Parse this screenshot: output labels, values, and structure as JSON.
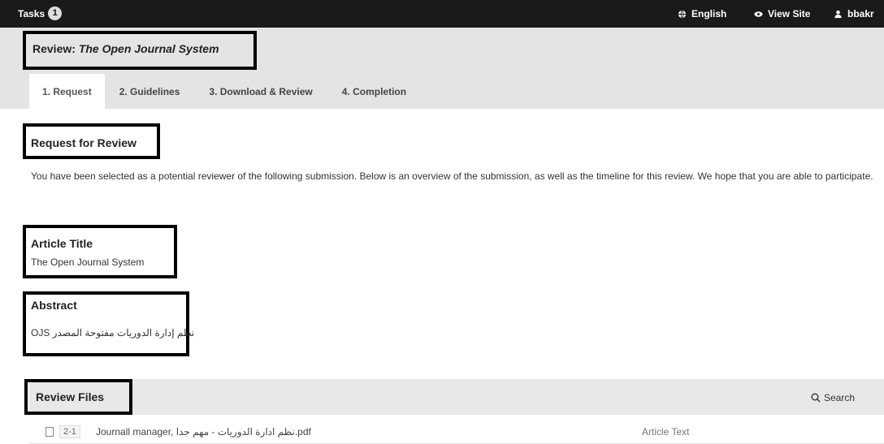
{
  "topbar": {
    "tasks_label": "Tasks",
    "tasks_count": "1",
    "language": "English",
    "view_site": "View Site",
    "user": "bbakr",
    "icons": [
      "globe-icon",
      "eye-icon",
      "user-icon"
    ]
  },
  "header": {
    "title_prefix": "Review:",
    "title_journal": "The Open Journal System",
    "tabs": [
      {
        "label": "1. Request",
        "active": true
      },
      {
        "label": "2. Guidelines",
        "active": false
      },
      {
        "label": "3. Download & Review",
        "active": false
      },
      {
        "label": "4. Completion",
        "active": false
      }
    ]
  },
  "request": {
    "title": "Request for Review",
    "text": "You have been selected as a potential reviewer of the following submission. Below is an overview of the submission, as well as the timeline for this review. We hope that you are able to participate."
  },
  "article": {
    "label": "Article Title",
    "value": "The Open Journal System"
  },
  "abstract": {
    "label": "Abstract",
    "value": "OJS نظم إدارة الدوريات مفتوحة المصدر"
  },
  "review_files": {
    "title": "Review Files",
    "search_label": "Search",
    "rows": [
      {
        "id": "2-1",
        "name": "Journall manager, نظم ادارة الدوريات - مهم جدا.pdf",
        "type": "Article Text"
      }
    ]
  }
}
